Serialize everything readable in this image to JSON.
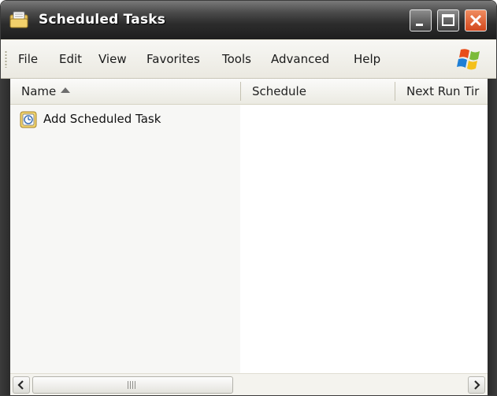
{
  "window": {
    "title": "Scheduled Tasks",
    "title_icon": "scheduled-tasks-folder-icon",
    "controls": {
      "minimize": "minimize-icon",
      "maximize": "maximize-icon",
      "close": "close-icon"
    },
    "colors": {
      "titlebar": "#2c2c2c",
      "close_button": "#d2471c"
    }
  },
  "menubar": {
    "items": [
      "File",
      "Edit",
      "View",
      "Favorites",
      "Tools",
      "Advanced",
      "Help"
    ],
    "logo": "windows-flag-icon"
  },
  "list": {
    "columns": [
      {
        "label": "Name",
        "sort": "ascending"
      },
      {
        "label": "Schedule"
      },
      {
        "label": "Next Run Tir"
      }
    ],
    "items": [
      {
        "label": "Add Scheduled Task",
        "icon": "add-scheduled-task-icon"
      }
    ]
  },
  "scrollbar": {
    "grip_text": "III",
    "left_icon": "scroll-left-arrow-icon",
    "right_icon": "scroll-right-arrow-icon"
  }
}
